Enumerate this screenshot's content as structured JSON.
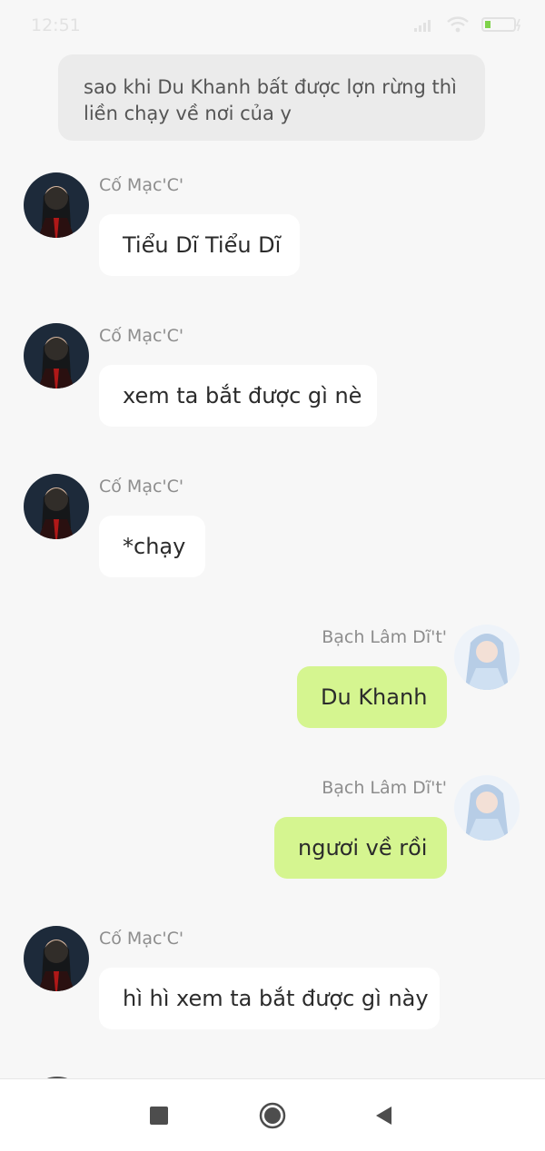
{
  "status": {
    "time": "12:51"
  },
  "narration": {
    "text": "sao khi Du Khanh  bất được lợn rừng thì liền chạy về nơi của y"
  },
  "messages": [
    {
      "sender": "Cố Mạc'C'",
      "text": "Tiểu Dĩ Tiểu Dĩ",
      "side": "left"
    },
    {
      "sender": "Cố Mạc'C'",
      "text": "xem ta bắt được gì nè",
      "side": "left"
    },
    {
      "sender": "Cố Mạc'C'",
      "text": "*chạy",
      "side": "left"
    },
    {
      "sender": "Bạch Lâm Dĩ't'",
      "text": "Du Khanh",
      "side": "right"
    },
    {
      "sender": "Bạch Lâm Dĩ't'",
      "text": "ngươi về rồi",
      "side": "right"
    },
    {
      "sender": "Cố Mạc'C'",
      "text": "hì hì xem ta bắt được gì này",
      "side": "left"
    }
  ],
  "colors": {
    "left_bubble": "#ffffff",
    "right_bubble": "#d5f590",
    "background": "#f7f7f7"
  },
  "nav": {
    "icons": [
      "square-recents-icon",
      "circle-home-icon",
      "triangle-back-icon"
    ]
  }
}
